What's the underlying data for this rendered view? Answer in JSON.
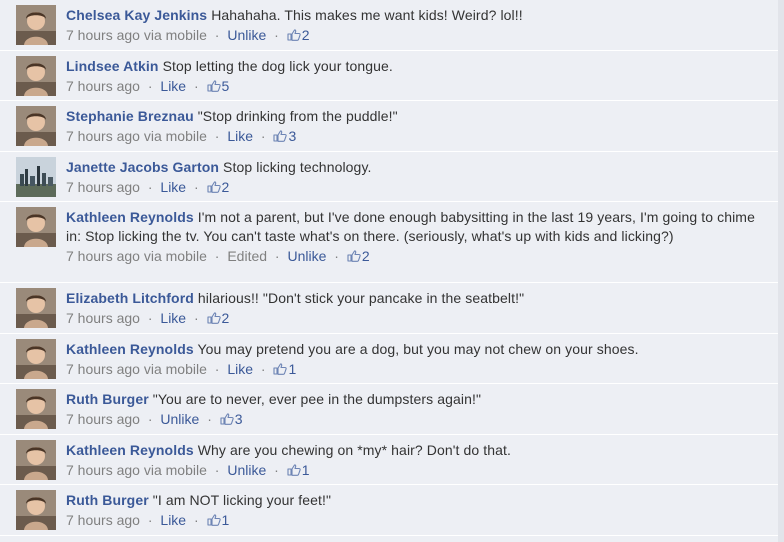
{
  "theme": {
    "link_color": "#3b5998",
    "meta_color": "#808080",
    "background": "#edeff4"
  },
  "comments": [
    {
      "author": "Chelsea Kay Jenkins",
      "text": "Hahahaha. This makes me want kids! Weird? lol!!",
      "time": "7 hours ago",
      "via": "via mobile",
      "edited": "",
      "action": "Unlike",
      "likes": "2",
      "avatar_icon": "person-avatar-icon"
    },
    {
      "author": "Lindsee Atkin",
      "text": "Stop letting the dog lick your tongue.",
      "time": "7 hours ago",
      "via": "",
      "edited": "",
      "action": "Like",
      "likes": "5",
      "avatar_icon": "person-avatar-icon"
    },
    {
      "author": "Stephanie Breznau",
      "text": "\"Stop drinking from the puddle!\"",
      "time": "7 hours ago",
      "via": "via mobile",
      "edited": "",
      "action": "Like",
      "likes": "3",
      "avatar_icon": "person-avatar-icon"
    },
    {
      "author": "Janette Jacobs Garton",
      "text": "Stop licking technology.",
      "time": "7 hours ago",
      "via": "",
      "edited": "",
      "action": "Like",
      "likes": "2",
      "avatar_icon": "skyline-avatar-icon"
    },
    {
      "author": "Kathleen Reynolds",
      "text": "I'm not a parent, but I've done enough babysitting in the last 19 years, I'm going to chime in: Stop licking the tv. You can't taste what's on there. (seriously, what's up with kids and licking?)",
      "time": "7 hours ago",
      "via": "via mobile",
      "edited": "Edited",
      "action": "Unlike",
      "likes": "2",
      "avatar_icon": "person-avatar-icon"
    },
    {
      "author": "Elizabeth Litchford",
      "text": "hilarious!! \"Don't stick your pancake in the seatbelt!\"",
      "time": "7 hours ago",
      "via": "",
      "edited": "",
      "action": "Like",
      "likes": "2",
      "avatar_icon": "person-avatar-icon"
    },
    {
      "author": "Kathleen Reynolds",
      "text": "You may pretend you are a dog, but you may not chew on your shoes.",
      "time": "7 hours ago",
      "via": "via mobile",
      "edited": "",
      "action": "Like",
      "likes": "1",
      "avatar_icon": "person-avatar-icon"
    },
    {
      "author": "Ruth Burger",
      "text": "\"You are to never, ever pee in the dumpsters again!\"",
      "time": "7 hours ago",
      "via": "",
      "edited": "",
      "action": "Unlike",
      "likes": "3",
      "avatar_icon": "person-avatar-icon"
    },
    {
      "author": "Kathleen Reynolds",
      "text": "Why are you chewing on *my* hair? Don't do that.",
      "time": "7 hours ago",
      "via": "via mobile",
      "edited": "",
      "action": "Unlike",
      "likes": "1",
      "avatar_icon": "person-avatar-icon"
    },
    {
      "author": "Ruth Burger",
      "text": "\"I am NOT licking your feet!\"",
      "time": "7 hours ago",
      "via": "",
      "edited": "",
      "action": "Like",
      "likes": "1",
      "avatar_icon": "person-avatar-icon"
    }
  ]
}
